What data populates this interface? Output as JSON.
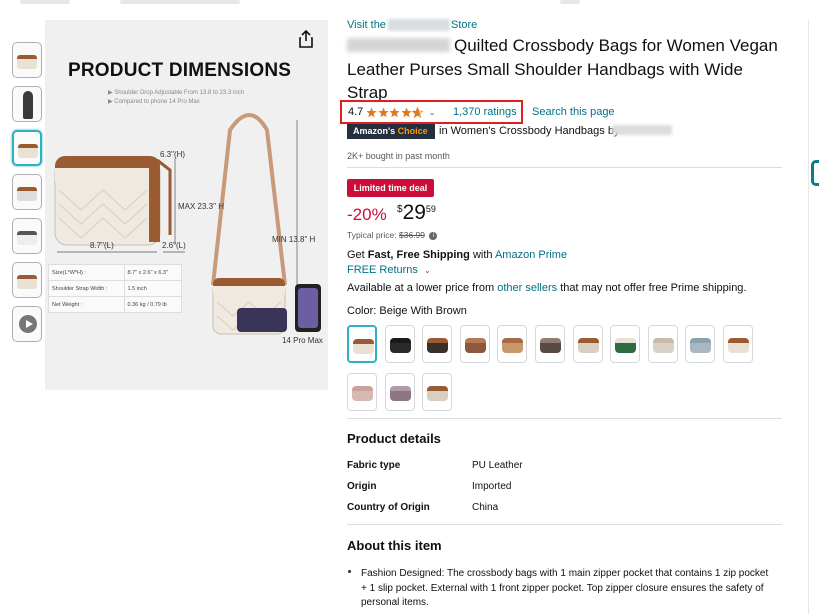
{
  "store": {
    "prefix": "Visit the",
    "suffix": "Store"
  },
  "product": {
    "title": "Quilted Crossbody Bags for Women Vegan Leather Purses Small Shoulder Handbags with Wide Strap",
    "rating": "4.7",
    "ratings_count": "1,370 ratings",
    "search_link": "Search this page",
    "choice_badge_a": "Amazon's",
    "choice_badge_b": "Choice",
    "choice_category": "in Women's Crossbody Handbags by",
    "bought": "2K+ bought in past month",
    "deal_badge": "Limited time deal",
    "discount": "-20%",
    "price_symbol": "$",
    "price_whole": "29",
    "price_fraction": "59",
    "typical_label": "Typical price:",
    "typical_price": "$36.99",
    "shipping_get": "Get",
    "shipping_bold": "Fast, Free Shipping",
    "shipping_with": "with",
    "shipping_prime": "Amazon Prime",
    "free_returns": "FREE Returns",
    "lower_a": "Available at a lower price from",
    "lower_link": "other sellers",
    "lower_b": "that may not offer free Prime shipping.",
    "color_label": "Color: Beige With Brown"
  },
  "image": {
    "title": "PRODUCT DIMENSIONS",
    "sub1": "▶ Shoulder Drop Adjustable From 13.8 to 23.3 inch",
    "sub2": "▶ Compared to phone 14 Pro Max",
    "height": "6.3\"(H)",
    "max": "MAX 23.3\" H",
    "length": "8.7\"(L)",
    "width": "2.6\"(L)",
    "min": "MIN 13.8\" H",
    "phone": "14 Pro Max",
    "spec": [
      {
        "k": "Size(L*W*H) :",
        "v": "8.7\" x 2.6\" x 6.3\""
      },
      {
        "k": "Shoulder Strap Width :",
        "v": "1.5 inch"
      },
      {
        "k": "Net Weight :",
        "v": "0.36 kg / 0.79 lb"
      }
    ]
  },
  "swatch_colors": [
    [
      "#e8e0d4",
      "#9a5b33"
    ],
    [
      "#2b2b2b",
      "#1a1a1a"
    ],
    [
      "#3a302a",
      "#9a5b33"
    ],
    [
      "#8b5a3c",
      "#b77a52"
    ],
    [
      "#c9976c",
      "#a86b45"
    ],
    [
      "#5a4a44",
      "#8e7b73"
    ],
    [
      "#d8cfc4",
      "#9a5b33"
    ],
    [
      "#2e6b3f",
      "#e8e0d4"
    ],
    [
      "#d9d2c6",
      "#c8bba9"
    ],
    [
      "#a9b7c2",
      "#8ea1ae"
    ],
    [
      "#e8e0d4",
      "#9a5b33"
    ],
    [
      "#d7b8b2",
      "#c8a29b"
    ],
    [
      "#8e7783",
      "#b09aa5"
    ],
    [
      "#d8cec2",
      "#9a5b33"
    ]
  ],
  "details": {
    "title": "Product details",
    "rows": [
      {
        "k": "Fabric type",
        "v": "PU Leather"
      },
      {
        "k": "Origin",
        "v": "Imported"
      },
      {
        "k": "Country of Origin",
        "v": "China"
      }
    ]
  },
  "about": {
    "title": "About this item",
    "bullet1": "Fashion Designed: The crossbody bags with 1 main zipper pocket that contains 1 zip pocket + 1 slip pocket. External with 1 front zipper pocket. Top zipper closure ensures the safety of personal items."
  },
  "colors": {
    "link": "#007185",
    "deal": "#cc0c39",
    "star": "#de7921",
    "highlight": "#e02020",
    "selected": "#2bb3c5"
  }
}
